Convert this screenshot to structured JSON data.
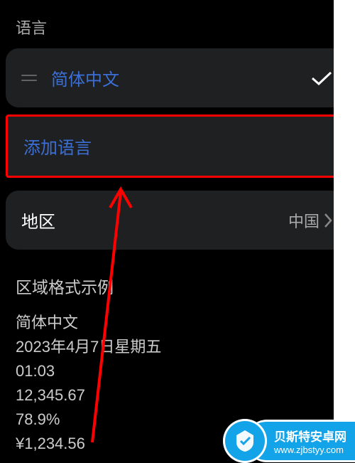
{
  "section_language_title": "语言",
  "current_language_item": {
    "label": "简体中文"
  },
  "add_language_label": "添加语言",
  "region_row": {
    "label": "地区",
    "value": "中国"
  },
  "region_format_example": {
    "title": "区域格式示例",
    "locale_name": "简体中文",
    "date_line": "2023年4月7日星期五",
    "time_line": "01:03",
    "number_line": "12,345.67",
    "percent_line": "78.9%",
    "currency_line": "¥1,234.56"
  },
  "watermark": {
    "line1": "贝斯特安卓网",
    "line2": "www.zjbstyy.com"
  }
}
